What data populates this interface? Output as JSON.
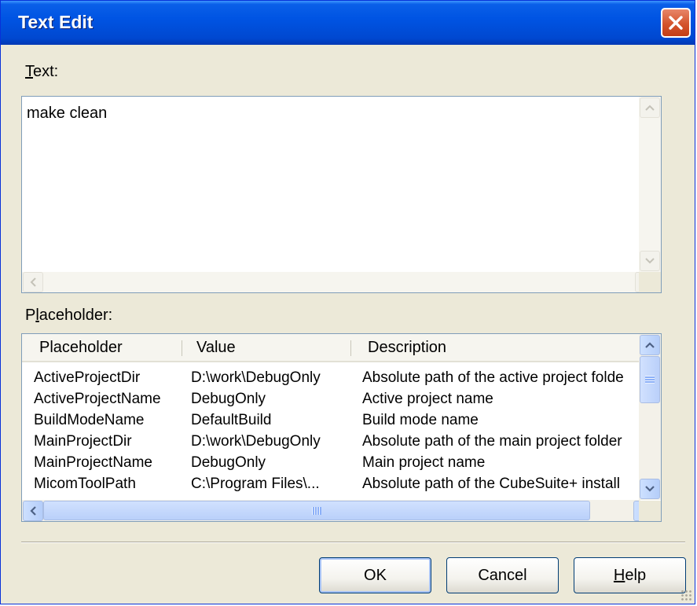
{
  "window": {
    "title": "Text Edit"
  },
  "text_label": {
    "accel": "T",
    "rest": "ext:"
  },
  "text_value": "make clean",
  "placeholder_label": {
    "before": "P",
    "accel": "l",
    "after": "aceholder:"
  },
  "table": {
    "columns": [
      "Placeholder",
      "Value",
      "Description"
    ],
    "rows": [
      {
        "placeholder": "ActiveProjectDir",
        "value": "D:\\work\\DebugOnly",
        "description": "Absolute path of the active project folde"
      },
      {
        "placeholder": "ActiveProjectName",
        "value": "DebugOnly",
        "description": "Active project name"
      },
      {
        "placeholder": "BuildModeName",
        "value": "DefaultBuild",
        "description": "Build mode name"
      },
      {
        "placeholder": "MainProjectDir",
        "value": "D:\\work\\DebugOnly",
        "description": "Absolute path of the main project folder"
      },
      {
        "placeholder": "MainProjectName",
        "value": "DebugOnly",
        "description": "Main project name"
      },
      {
        "placeholder": "MicomToolPath",
        "value": "C:\\Program Files\\...",
        "description": "Absolute path of the CubeSuite+  install"
      }
    ]
  },
  "buttons": {
    "ok": "OK",
    "cancel": "Cancel",
    "help": {
      "accel": "H",
      "rest": "elp"
    }
  }
}
